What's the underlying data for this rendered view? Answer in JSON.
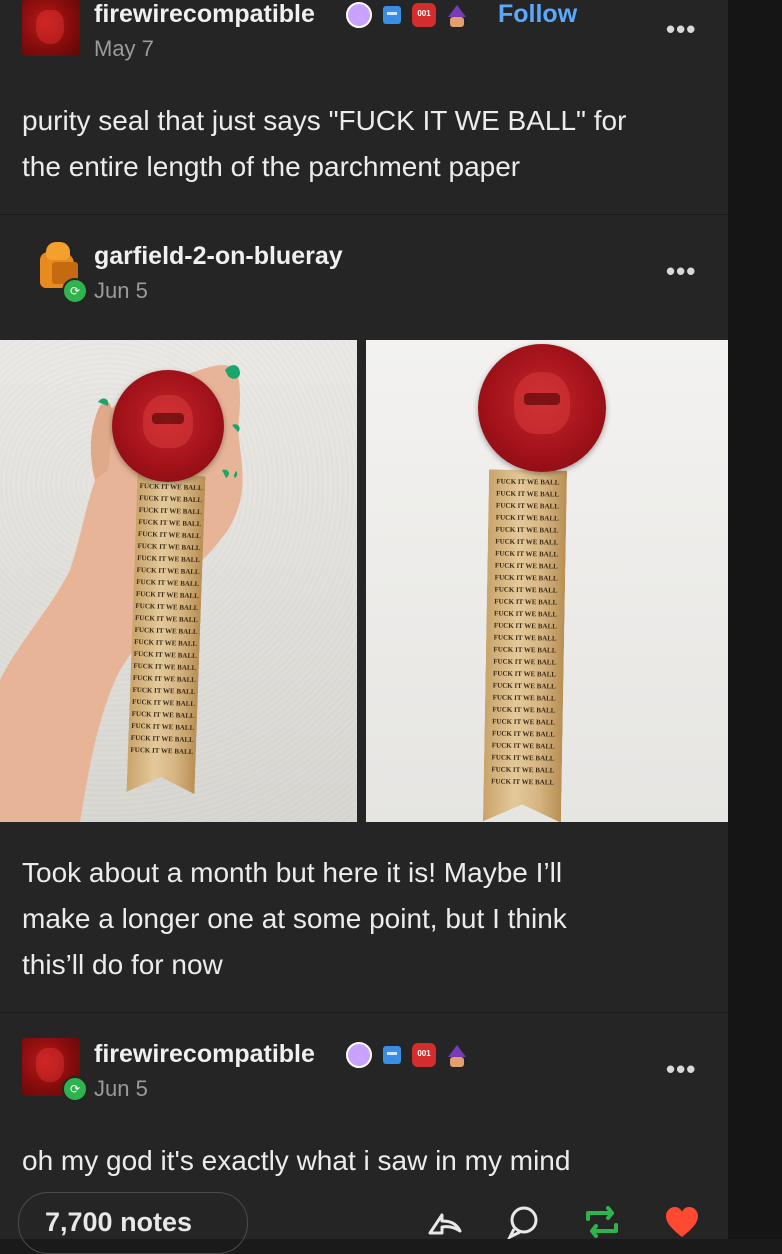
{
  "post1": {
    "username": "firewirecompatible",
    "follow_label": "Follow",
    "date": "May 7",
    "body_lines": [
      "purity seal that just says \"FUCK IT WE BALL\" for",
      "the entire length of the parchment paper"
    ],
    "badges": [
      "paw-badge-icon",
      "robot-badge-icon",
      "hex-badge-icon",
      "wizard-badge-icon"
    ]
  },
  "post2": {
    "username": "garfield-2-on-blueray",
    "date": "Jun 5",
    "scroll_text": "FUCK IT WE BALL",
    "body_lines": [
      "Took about a month but here it is! Maybe I’ll",
      "make a longer one at some point, but I think",
      "this’ll do for now"
    ]
  },
  "post3": {
    "username": "firewirecompatible",
    "date": "Jun 5",
    "body": "oh my god it's exactly what i saw in my mind"
  },
  "footer": {
    "notes": "7,700 notes"
  },
  "more_label": "•••",
  "colors": {
    "accent_link": "#5aa9ff",
    "reblog_green": "#2fb34d",
    "like_red": "#ff4930",
    "wax_red": "#a3121a"
  }
}
